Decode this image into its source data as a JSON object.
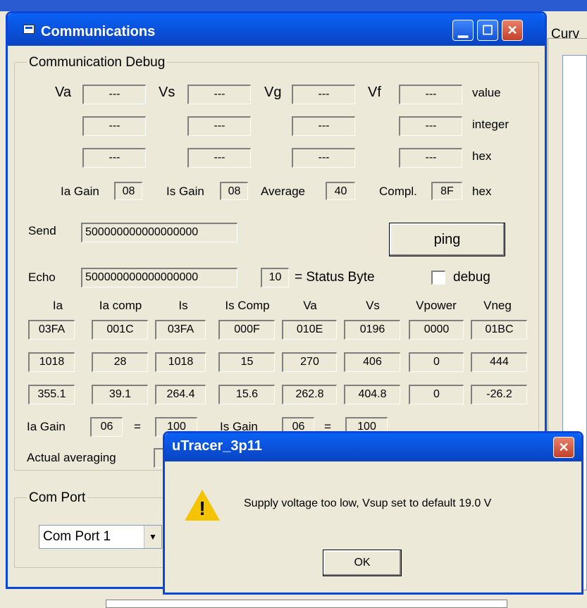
{
  "background": {
    "curve_label": "Curv"
  },
  "window": {
    "title": "Communications"
  },
  "debug": {
    "legend": "Communication Debug",
    "row_labels": {
      "va": "Va",
      "vs": "Vs",
      "vg": "Vg",
      "vf": "Vf"
    },
    "units": [
      "value",
      "integer",
      "hex"
    ],
    "placeholder": "---",
    "gain": {
      "ia_label": "Ia Gain",
      "ia_val": "08",
      "is_label": "Is Gain",
      "is_val": "08",
      "avg_label": "Average",
      "avg_val": "40",
      "compl_label": "Compl.",
      "compl_val": "8F",
      "unit": "hex"
    },
    "send_label": "Send",
    "send_value": "500000000000000000",
    "ping_label": "ping",
    "echo_label": "Echo",
    "echo_value": "500000000000000000",
    "status_value": "10",
    "status_label": "= Status Byte",
    "debug_label": "debug",
    "table_headers": [
      "Ia",
      "Ia comp",
      "Is",
      "Is Comp",
      "Va",
      "Vs",
      "Vpower",
      "Vneg"
    ],
    "rows": [
      [
        "03FA",
        "001C",
        "03FA",
        "000F",
        "010E",
        "0196",
        "0000",
        "01BC"
      ],
      [
        "1018",
        "28",
        "1018",
        "15",
        "270",
        "406",
        "0",
        "444"
      ],
      [
        "355.1",
        "39.1",
        "264.4",
        "15.6",
        "262.8",
        "404.8",
        "0",
        "-26.2"
      ]
    ],
    "ia_gain_label": "Ia Gain",
    "ia_gain_val": "06",
    "ia_gain_eq": "=",
    "ia_gain_res": "100",
    "is_gain_label": "Is Gain",
    "is_gain_val": "06",
    "is_gain_eq": "=",
    "is_gain_res": "100",
    "actual_avg_label": "Actual averaging"
  },
  "comport": {
    "legend": "Com Port",
    "selected": "Com Port 1"
  },
  "dialog": {
    "title": "uTracer_3p11",
    "message": "Supply voltage too low, Vsup set to default 19.0 V",
    "ok_label": "OK"
  },
  "colors": {
    "titlebar": "#0a4fd6",
    "close": "#c4402a",
    "warning": "#f5c400"
  }
}
